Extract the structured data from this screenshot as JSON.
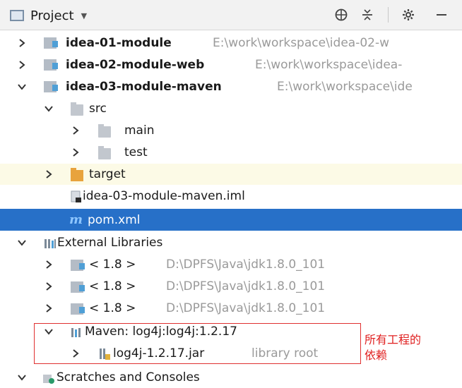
{
  "toolbar": {
    "view_label": "Project",
    "buttons": [
      "globe-icon",
      "collapse-icon",
      "gear-icon",
      "minimize-icon"
    ]
  },
  "tree": {
    "module1": {
      "name": "idea-01-module",
      "path": "E:\\work\\workspace\\idea-02-w"
    },
    "module2": {
      "name": "idea-02-module-web",
      "path": "E:\\work\\workspace\\idea-"
    },
    "module3": {
      "name": "idea-03-module-maven",
      "path": "E:\\work\\workspace\\ide"
    },
    "src": "src",
    "main": "main",
    "test": "test",
    "target": "target",
    "iml": "idea-03-module-maven.iml",
    "pom_icon": "m",
    "pom": "pom.xml",
    "external_libraries": "External Libraries",
    "jdk": [
      {
        "version": "< 1.8 >",
        "path": "D:\\DPFS\\Java\\jdk1.8.0_101"
      },
      {
        "version": "< 1.8 >",
        "path": "D:\\DPFS\\Java\\jdk1.8.0_101"
      },
      {
        "version": "< 1.8 >",
        "path": "D:\\DPFS\\Java\\jdk1.8.0_101"
      }
    ],
    "maven_lib": "Maven: log4j:log4j:1.2.17",
    "jar": {
      "name": "log4j-1.2.17.jar",
      "note": "library root"
    },
    "scratches": "Scratches and Consoles"
  },
  "annotation": {
    "line1": "所有工程的",
    "line2": "依赖"
  },
  "colors": {
    "selection": "#2770c8",
    "highlight": "#fcfae6",
    "annotation": "#e02020"
  }
}
